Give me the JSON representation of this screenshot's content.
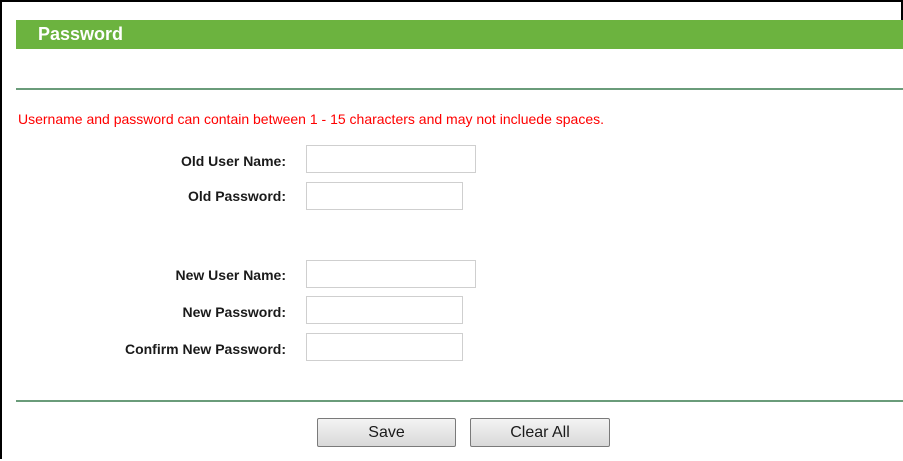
{
  "header": {
    "title": "Password"
  },
  "notice": {
    "text": "Username and password can contain between 1 - 15 characters and may not incluede spaces."
  },
  "form": {
    "old_user_name": {
      "label": "Old User Name:",
      "value": ""
    },
    "old_password": {
      "label": "Old Password:",
      "value": ""
    },
    "new_user_name": {
      "label": "New User Name:",
      "value": ""
    },
    "new_password": {
      "label": "New Password:",
      "value": ""
    },
    "confirm_new_password": {
      "label": "Confirm New Password:",
      "value": ""
    }
  },
  "buttons": {
    "save": "Save",
    "clear_all": "Clear All"
  },
  "colors": {
    "header_bg": "#6cb33f",
    "notice_text": "#ff0000",
    "divider": "#6a9c7a"
  }
}
